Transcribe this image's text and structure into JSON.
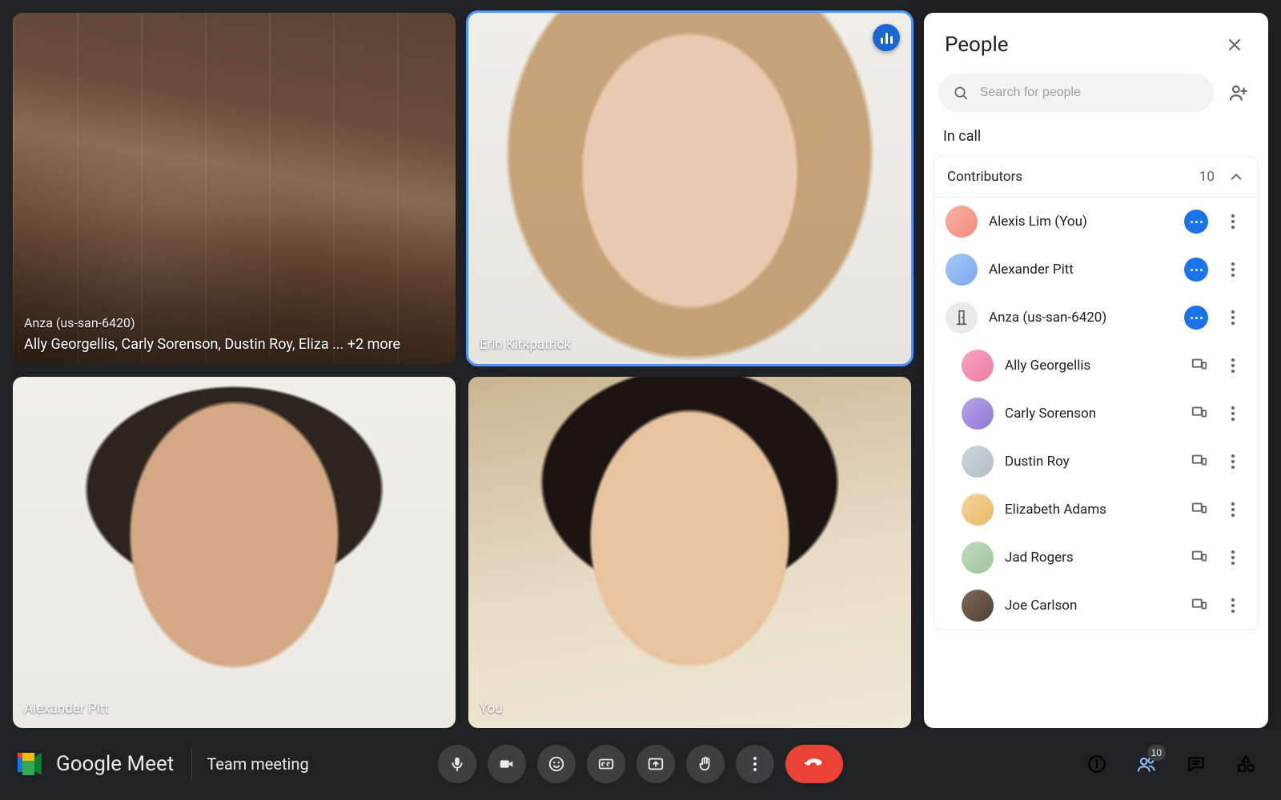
{
  "product": {
    "name": "Google Meet"
  },
  "meeting": {
    "name": "Team meeting",
    "participant_count": 10
  },
  "tiles": {
    "room": {
      "label": "Anza (us-san-6420)",
      "people_line": "Ally Georgellis, Carly Sorenson, Dustin Roy, Eliza ... +2 more"
    },
    "erin": {
      "name": "Erin Kirkpatrick",
      "is_speaking": true
    },
    "alex": {
      "name": "Alexander Pitt"
    },
    "you": {
      "name": "You"
    }
  },
  "people_panel": {
    "title": "People",
    "search_placeholder": "Search for people",
    "section_label": "In call",
    "contributors": {
      "label": "Contributors",
      "count": "10",
      "expanded": true
    },
    "participants": [
      {
        "name": "Alexis Lim (You)",
        "badge": "host",
        "nested": false
      },
      {
        "name": "Alexander Pitt",
        "badge": "host",
        "nested": false
      },
      {
        "name": "Anza (us-san-6420)",
        "badge": "host",
        "nested": false,
        "is_room": true
      },
      {
        "name": "Ally Georgellis",
        "badge": "device",
        "nested": true
      },
      {
        "name": "Carly Sorenson",
        "badge": "device",
        "nested": true
      },
      {
        "name": "Dustin Roy",
        "badge": "device",
        "nested": true
      },
      {
        "name": "Elizabeth Adams",
        "badge": "device",
        "nested": true
      },
      {
        "name": "Jad Rogers",
        "badge": "device",
        "nested": true
      },
      {
        "name": "Joe Carlson",
        "badge": "device",
        "nested": true
      }
    ]
  },
  "avatars": [
    "linear-gradient(135deg,#f7b3a4,#ef897a)",
    "linear-gradient(135deg,#a4c9f7,#7aa8ef)",
    "room",
    "linear-gradient(135deg,#f7a4c6,#ef7aa1)",
    "linear-gradient(135deg,#b8a5e6,#8f76d6)",
    "linear-gradient(135deg,#cfd8dc,#aebcc3)",
    "linear-gradient(135deg,#f3d69e,#e9b865)",
    "linear-gradient(135deg,#c2d9c0,#9dc79a)",
    "linear-gradient(135deg,#7f6a5a,#4f3f33)"
  ]
}
